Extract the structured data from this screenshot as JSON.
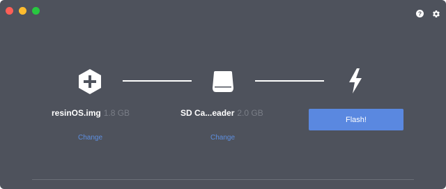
{
  "window": {
    "traffic_lights": [
      "close",
      "minimize",
      "maximize"
    ]
  },
  "header": {
    "icons": [
      "help-icon",
      "gear-icon"
    ]
  },
  "steps": [
    {
      "icon": "plus-hexagon-icon",
      "label": "resinOS.img",
      "size": "1.8 GB",
      "change_label": "Change"
    },
    {
      "icon": "drive-icon",
      "label": "SD Ca...eader",
      "size": "2.0 GB",
      "change_label": "Change"
    },
    {
      "icon": "lightning-icon",
      "button_label": "Flash!"
    }
  ],
  "colors": {
    "background": "#4e525c",
    "accent": "#5a88e0",
    "link": "#5d8fe0",
    "muted_text": "#7a7e87"
  }
}
